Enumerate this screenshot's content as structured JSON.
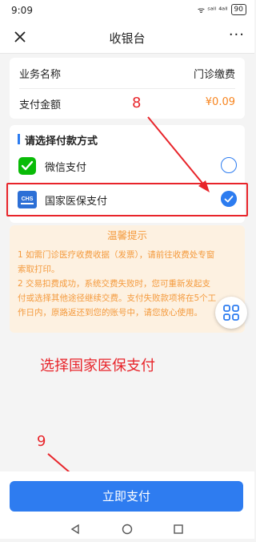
{
  "status_bar": {
    "time": "9:09",
    "signal": "ᯤ ˢᵃˡˡ ⁴ᵃˡˡ",
    "battery": "90"
  },
  "nav": {
    "title": "收银台",
    "more": "···"
  },
  "order": {
    "business_label": "业务名称",
    "business_value": "门诊缴费",
    "amount_label": "支付金额",
    "amount_value": "¥0.09"
  },
  "payment": {
    "heading": "请选择付款方式",
    "methods": [
      {
        "name": "微信支付",
        "icon": "wechat-pay-icon",
        "selected": false
      },
      {
        "name": "国家医保支付",
        "icon": "chs-medical-insurance-icon",
        "selected": true
      }
    ]
  },
  "notice": {
    "title": "温馨提示",
    "line1": "1 如需门诊医疗收费收据（发票），请前往收费处专窗索取打印。",
    "line2": "2 交易扣费成功，系统交费失败时，您可重新发起支付或选择其他途径继续交费。支付失败款项将在5个工作日内，原路返还到您的账号中，请您放心使用。"
  },
  "annotations": {
    "step8": "8",
    "step9": "9",
    "caption": "选择国家医保支付"
  },
  "footer": {
    "pay_button": "立即支付"
  },
  "colors": {
    "accent": "#2e7cf0",
    "amount": "#f7841e",
    "notice_text": "#f49a3d",
    "annotation": "#e8242a"
  }
}
